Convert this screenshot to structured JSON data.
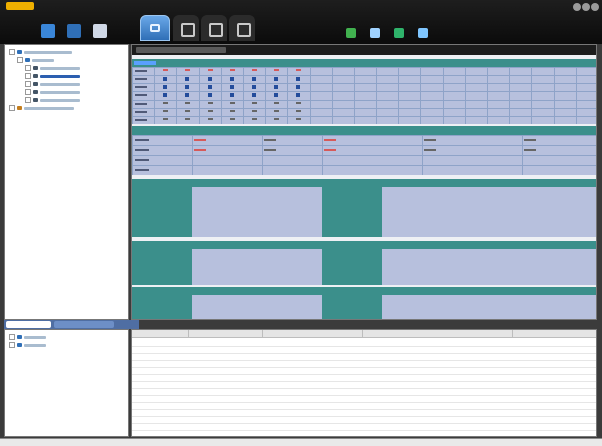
{
  "window": {
    "logo": "device-manager-logo"
  },
  "toolbar": {
    "left_buttons": [
      {
        "name": "connect-icon",
        "color": "#3a86d8"
      },
      {
        "name": "refresh-icon",
        "color": "#2f6fb7"
      },
      {
        "name": "disconnect-icon",
        "color": "#d0d8e6"
      }
    ],
    "mode_tabs": [
      "home-tab",
      "device-tab",
      "config-tab",
      "tools-tab"
    ],
    "right_icons": [
      {
        "name": "monitor-icon",
        "color": "#41b14f"
      },
      {
        "name": "camera-icon",
        "color": "#9fd2ff"
      },
      {
        "name": "tool-icon",
        "color": "#2fb36b"
      },
      {
        "name": "edit-icon",
        "color": "#7fc6ff"
      }
    ]
  },
  "tree": {
    "rows": [
      {
        "level": 0,
        "icon": "network-icon",
        "color": "#2f6fb7",
        "len": 48,
        "expanded": true
      },
      {
        "level": 1,
        "icon": "group-icon",
        "color": "#2f6fb7",
        "len": 22,
        "expanded": true
      },
      {
        "level": 2,
        "icon": "device-icon",
        "color": "#456",
        "len": 40
      },
      {
        "level": 2,
        "icon": "device-icon",
        "color": "#456",
        "len": 40,
        "selected": true
      },
      {
        "level": 2,
        "icon": "device-icon",
        "color": "#456",
        "len": 40
      },
      {
        "level": 2,
        "icon": "device-icon",
        "color": "#456",
        "len": 40
      },
      {
        "level": 2,
        "icon": "device-icon",
        "color": "#456",
        "len": 40
      },
      {
        "level": 0,
        "icon": "folder-icon",
        "color": "#c47e1e",
        "len": 50
      }
    ]
  },
  "content": {
    "port_rows": 7,
    "port_columns": 21,
    "status_rows": 4,
    "status_columns": 5
  },
  "bottom_left": {
    "tabs": [
      "alarm-tab",
      "log-tab"
    ],
    "rows": [
      {
        "icon": "alarm-icon",
        "color": "#2f6fb7"
      },
      {
        "icon": "log-icon",
        "color": "#2f6fb7"
      }
    ]
  },
  "bottom_right": {
    "rows": 14
  }
}
